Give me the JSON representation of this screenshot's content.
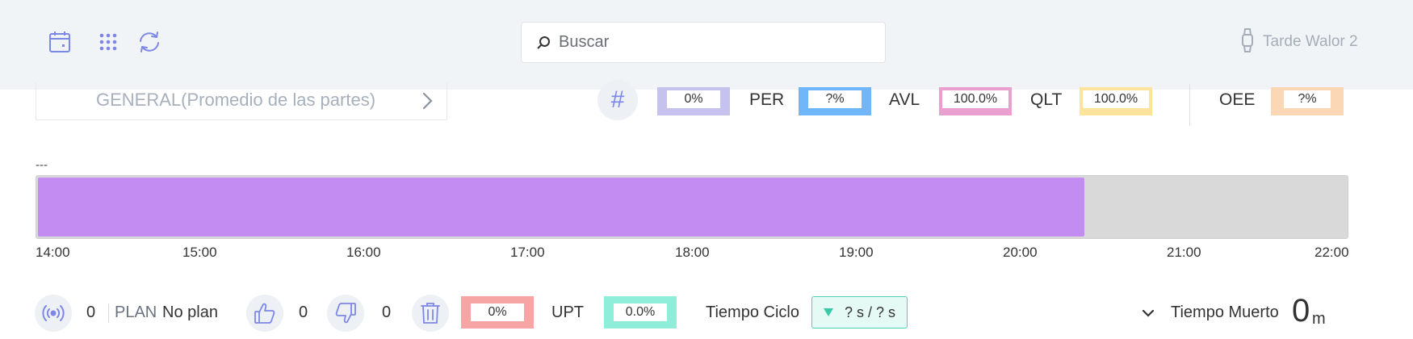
{
  "topbar": {
    "icons": [
      "calendar-icon",
      "apps-grid-icon",
      "refresh-icon"
    ],
    "search": {
      "placeholder": "Buscar",
      "value": ""
    },
    "user": {
      "icon": "watch-icon",
      "name": "Tarde Walor 2"
    }
  },
  "selector": {
    "label": "GENERAL(Promedio de las partes)",
    "icon": "chevron-right-icon"
  },
  "metrics": {
    "hash_icon": "#",
    "count": {
      "value": "0%",
      "color": "#c5c3ee"
    },
    "per": {
      "label": "PER",
      "value": "?%",
      "color": "#6fb6fb"
    },
    "avl": {
      "label": "AVL",
      "value": "100.0%",
      "color": "#e9a0cf"
    },
    "qlt": {
      "label": "QLT",
      "value": "100.0%",
      "color": "#fde39b"
    },
    "oee": {
      "label": "OEE",
      "value": "?%",
      "color": "#fcd7b6"
    }
  },
  "timeline": {
    "label": "---",
    "fill_fraction": 0.8,
    "fill_color": "#c28cf2",
    "track_color": "#d9d9d9",
    "ticks": [
      "14:00",
      "15:00",
      "16:00",
      "17:00",
      "18:00",
      "19:00",
      "20:00",
      "21:00",
      "22:00"
    ]
  },
  "bottom": {
    "signal_icon": "signal-icon",
    "signal_count": "0",
    "plan_label": "PLAN",
    "plan_value": "No plan",
    "like_icon": "thumbs-up-icon",
    "like_count": "0",
    "dislike_icon": "thumbs-down-icon",
    "dislike_count": "0",
    "trash_icon": "trash-icon",
    "waste": {
      "value": "0%",
      "color": "#f7a4a4"
    },
    "upt": {
      "label": "UPT",
      "value": "0.0%",
      "color": "#8eeed9"
    },
    "cycle": {
      "label": "Tiempo Ciclo",
      "value": "? s / ? s"
    },
    "dead_time": {
      "label": "Tiempo Muerto",
      "value": "0",
      "unit": "m"
    }
  }
}
